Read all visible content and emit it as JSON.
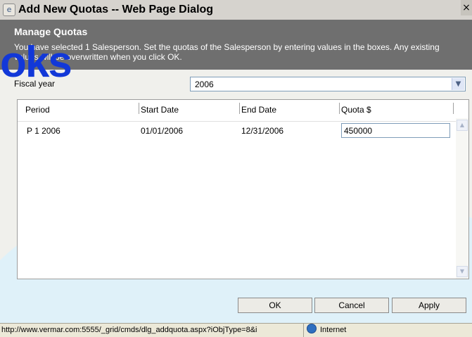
{
  "window": {
    "title": "Add New Quotas -- Web Page Dialog",
    "close_glyph": "×"
  },
  "header": {
    "heading": "Manage Quotas",
    "description": "You have selected 1 Salesperson. Set the quotas of the Salesperson by entering values in the boxes. Any existing values will be overwritten when you click OK."
  },
  "watermark": {
    "text": "oks"
  },
  "fiscal_year": {
    "label": "Fiscal year",
    "selected": "2006"
  },
  "grid": {
    "columns": [
      "Period",
      "Start Date",
      "End Date",
      "Quota $"
    ],
    "rows": [
      {
        "period": "P 1 2006",
        "start_date": "01/01/2006",
        "end_date": "12/31/2006",
        "quota": "450000"
      }
    ]
  },
  "buttons": {
    "ok": "OK",
    "cancel": "Cancel",
    "apply": "Apply"
  },
  "status": {
    "url": "http://www.vermar.com:5555/_grid/cmds/dlg_addquota.aspx?iObjType=8&i",
    "zone": "Internet"
  },
  "colors": {
    "header_band": "#6f6f6f",
    "watermark_blue": "#1238d8",
    "watermark_arc": "#dff1f9"
  }
}
